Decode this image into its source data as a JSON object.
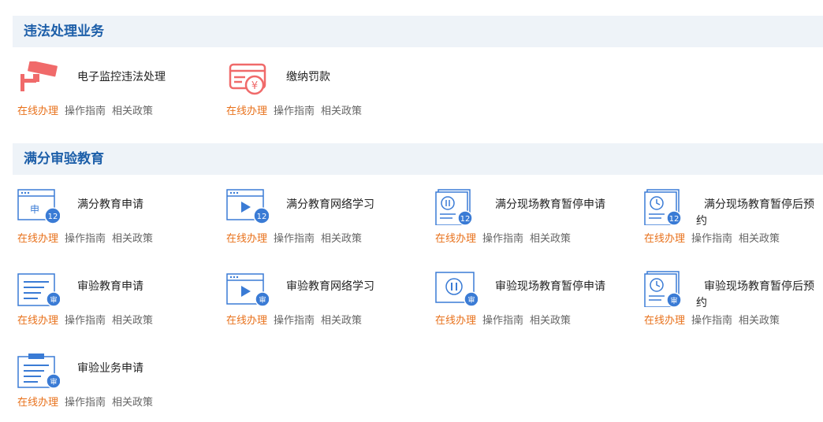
{
  "sections": [
    {
      "title": "违法处理业务"
    },
    {
      "title": "满分审验教育"
    }
  ],
  "items": [
    {
      "title": "电子监控违法处理",
      "icon": "surveillance-camera-icon",
      "badge": ""
    },
    {
      "title": "缴纳罚款",
      "icon": "fine-payment-icon",
      "badge": ""
    },
    {
      "title": "满分教育申请",
      "icon": "application-form-icon",
      "badge": "12",
      "icon_text": "申"
    },
    {
      "title": "满分教育网络学习",
      "icon": "video-play-icon",
      "badge": "12"
    },
    {
      "title": "满分现场教育暂停申请",
      "icon": "pause-icon",
      "badge": "12"
    },
    {
      "title": "满分现场教育暂停后预约",
      "icon": "clock-icon",
      "badge": "12"
    },
    {
      "title": "审验教育申请",
      "icon": "document-lines-icon",
      "badge": "审"
    },
    {
      "title": "审验教育网络学习",
      "icon": "video-play-icon",
      "badge": "审"
    },
    {
      "title": "审验现场教育暂停申请",
      "icon": "pause-icon",
      "badge": "审"
    },
    {
      "title": "审验现场教育暂停后预约",
      "icon": "clock-icon",
      "badge": "审"
    },
    {
      "title": "审验业务申请",
      "icon": "clipboard-icon",
      "badge": "审"
    }
  ],
  "links": {
    "online": "在线办理",
    "guide": "操作指南",
    "policy": "相关政策"
  },
  "colors": {
    "header_bg": "#eef3f8",
    "header_text": "#1d5fa9",
    "icon_blue": "#3a7bd5",
    "icon_red": "#f06a6a",
    "online_link": "#e8711b",
    "secondary_link": "#666666"
  }
}
